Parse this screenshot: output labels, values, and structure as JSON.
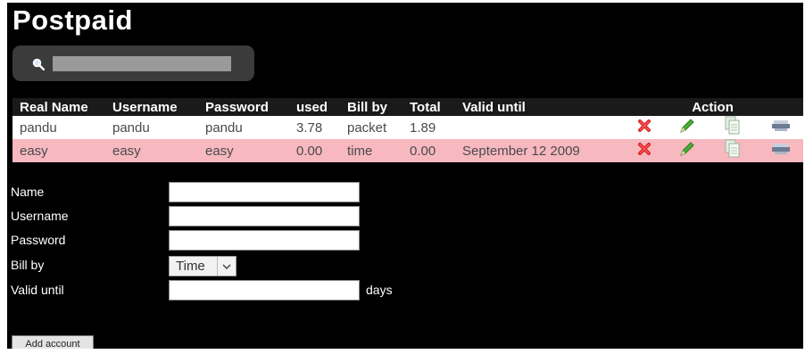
{
  "page": {
    "title": "Postpaid"
  },
  "search": {
    "value": ""
  },
  "table": {
    "headers": {
      "real_name": "Real Name",
      "username": "Username",
      "password": "Password",
      "used": "used",
      "bill_by": "Bill by",
      "total": "Total",
      "valid_until": "Valid until",
      "action": "Action"
    },
    "rows": [
      {
        "real_name": "pandu",
        "username": "pandu",
        "password": "pandu",
        "used": "3.78",
        "bill_by": "packet",
        "total": "1.89",
        "valid_until": ""
      },
      {
        "real_name": "easy",
        "username": "easy",
        "password": "easy",
        "used": "0.00",
        "bill_by": "time",
        "total": "0.00",
        "valid_until": "September 12 2009"
      }
    ],
    "action_icons": [
      "delete-icon",
      "edit-icon",
      "copy-icon",
      "print-icon"
    ]
  },
  "form": {
    "name_label": "Name",
    "username_label": "Username",
    "password_label": "Password",
    "bill_by_label": "Bill by",
    "bill_by_selected": "Time",
    "valid_until_label": "Valid until",
    "days_label": "days",
    "submit_label": "Add account",
    "name_value": "",
    "username_value": "",
    "password_value": "",
    "valid_until_value": ""
  },
  "colors": {
    "background": "#000000",
    "search_bar": "#3b3b3b",
    "row_highlight": "#f7b8c0",
    "delete_icon": "#d42020",
    "edit_icon": "#3c9a28"
  }
}
